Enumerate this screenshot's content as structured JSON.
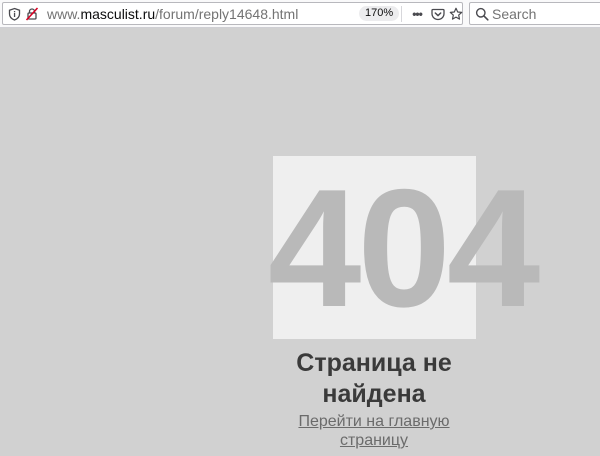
{
  "browser": {
    "url_prefix": "www.",
    "url_domain": "masculist.ru",
    "url_path": "/forum/reply14648.html",
    "zoom_level": "170%",
    "search_placeholder": "Search",
    "icons": {
      "info": "info-icon",
      "insecure": "insecure-connection-icon",
      "page_actions": "more-horizontal-icon",
      "pocket": "pocket-icon",
      "bookmark": "star-icon",
      "search": "magnifier-icon"
    }
  },
  "error_page": {
    "code": "404",
    "title": "Страница не найдена",
    "home_link": "Перейти на главную страницу"
  },
  "colors": {
    "page_background": "#d1d1d1",
    "code_box": "#efefef",
    "code_text": "#b9b9b9",
    "title_text": "#3a3a3a",
    "link_text": "#6b6b6b"
  }
}
